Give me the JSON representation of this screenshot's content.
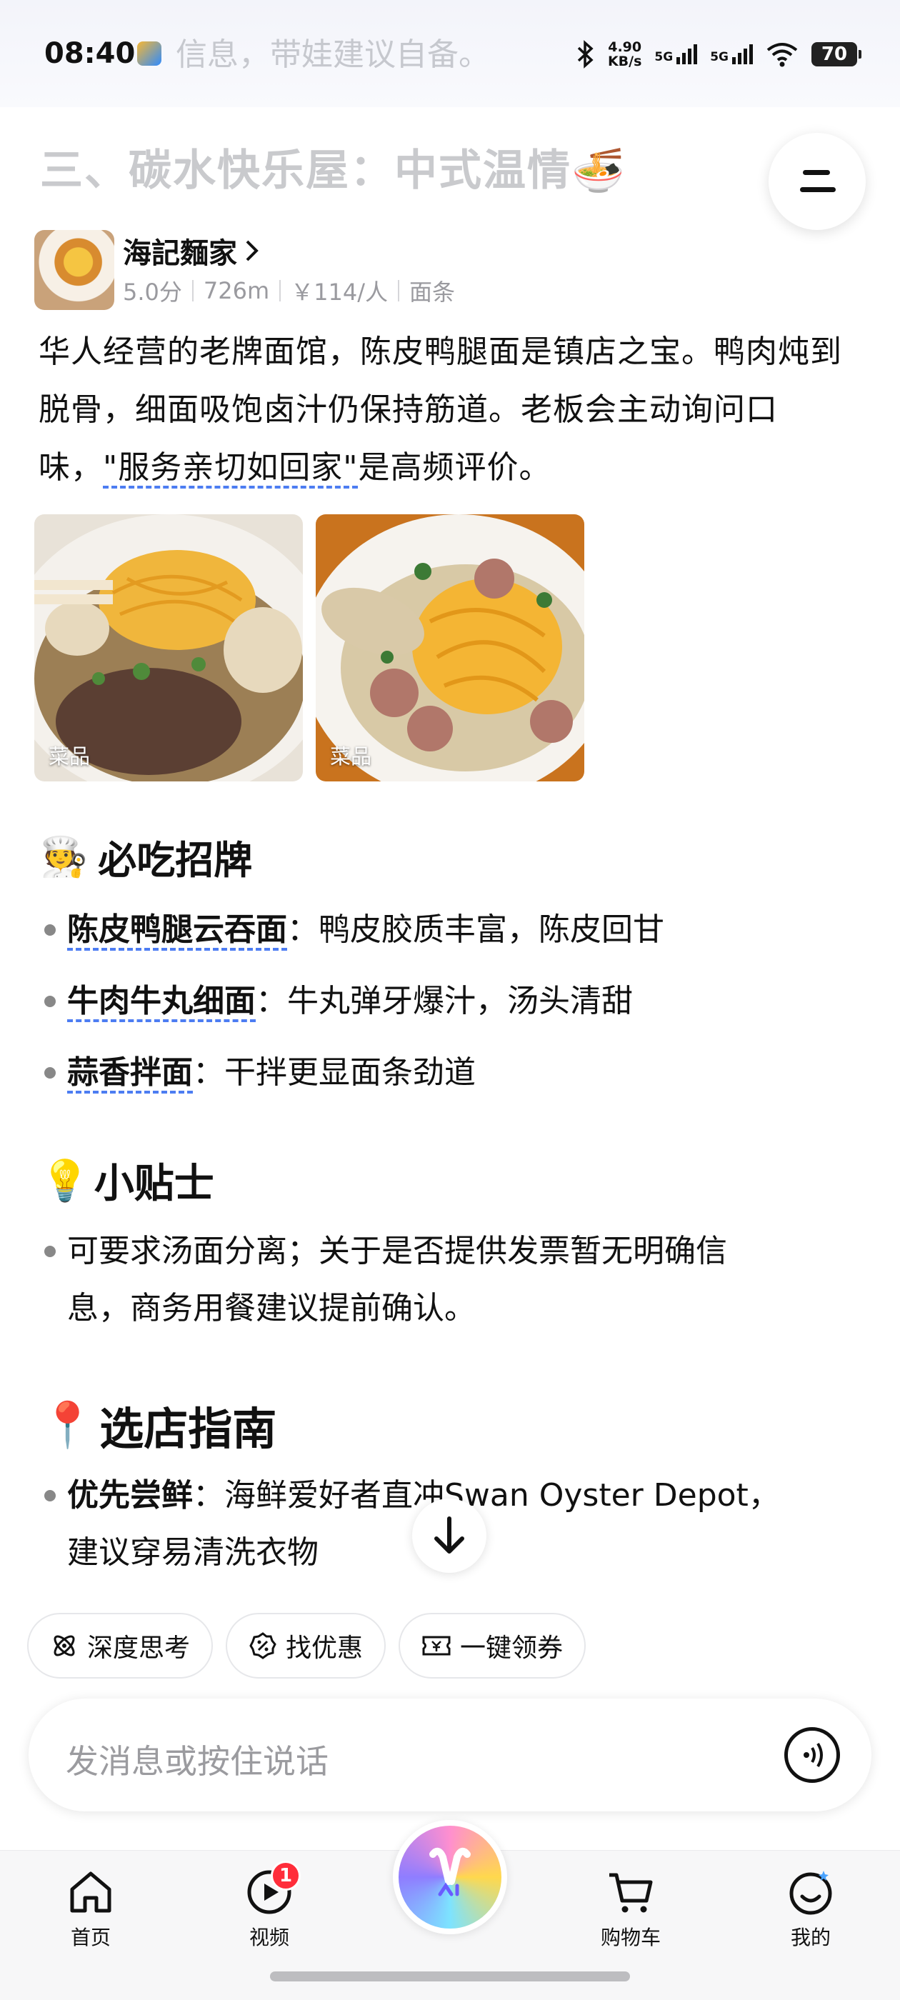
{
  "status_bar": {
    "time": "08:40",
    "faded_text": "信息，带娃建议自备。",
    "net_speed": "4.90",
    "net_unit": "KB/s",
    "sim1": "5G",
    "sim2": "5G",
    "battery": "70"
  },
  "faded_heading": "三、碳水快乐屋：中式温情🍜",
  "shop": {
    "name": "海記麵家",
    "rating": "5.0分",
    "distance": "726m",
    "price": "￥114/人",
    "category": "面条"
  },
  "description": {
    "part1": "华人经营的老牌面馆，陈皮鸭腿面是镇店之宝。鸭肉炖到脱骨，细面吸饱卤汁仍保持筋道。老板会主动询问口味，",
    "highlight": "\"服务亲切如回家\"",
    "part2": "是高频评价。"
  },
  "photos": [
    {
      "caption": "菜品"
    },
    {
      "caption": "菜品"
    }
  ],
  "section_must_eat": {
    "emoji": "🧑‍🍳",
    "title": "必吃招牌",
    "items": [
      {
        "name": "陈皮鸭腿云吞面",
        "desc": "：鸭皮胶质丰富，陈皮回甘"
      },
      {
        "name": "牛肉牛丸细面",
        "desc": "：牛丸弹牙爆汁，汤头清甜"
      },
      {
        "name": "蒜香拌面",
        "desc": "：干拌更显面条劲道"
      }
    ]
  },
  "section_tips": {
    "emoji": "💡",
    "title": "小贴士",
    "line1": "可要求汤面分离；关于是否提供发票暂无明确信",
    "line2": "息，商务用餐建议提前确认。"
  },
  "section_guide": {
    "emoji": "📍",
    "title": "选店指南",
    "item_bold": "优先尝鲜",
    "line1": "：海鲜爱好者直冲Swan Oyster Depot，",
    "line2": "建议穿易清洗衣物"
  },
  "chips": [
    {
      "label": "深度思考",
      "icon": "atom-icon"
    },
    {
      "label": "找优惠",
      "icon": "discount-icon"
    },
    {
      "label": "一键领券",
      "icon": "coupon-icon"
    }
  ],
  "input": {
    "placeholder": "发消息或按住说话"
  },
  "tabs": [
    {
      "label": "首页",
      "icon": "home-icon"
    },
    {
      "label": "视频",
      "icon": "video-icon",
      "badge": "1"
    },
    {
      "label": "购物车",
      "icon": "cart-icon"
    },
    {
      "label": "我的",
      "icon": "profile-icon"
    }
  ],
  "colors": {
    "link_underline": "#4d7df2",
    "badge": "#ff2d3a"
  }
}
